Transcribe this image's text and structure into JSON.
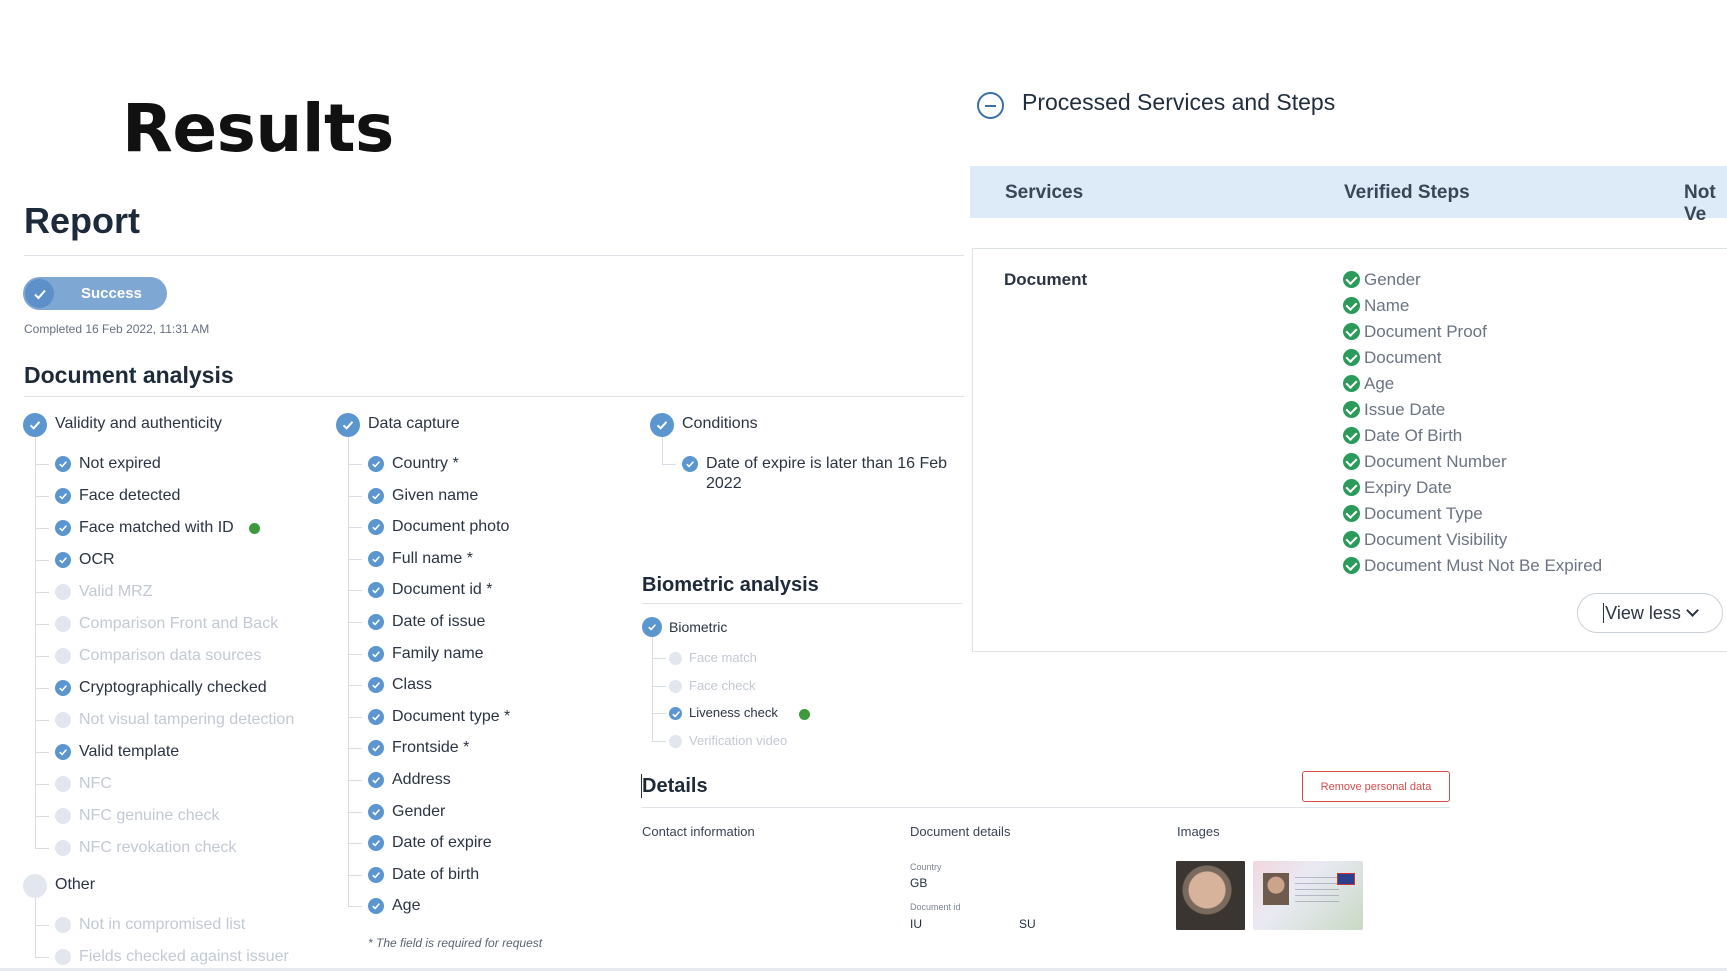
{
  "slide": {
    "title": "Results"
  },
  "report": {
    "title": "Report",
    "status": "Success",
    "completed": "Completed 16 Feb 2022, 11:31 AM"
  },
  "document_analysis": {
    "title": "Document analysis",
    "validity": {
      "label": "Validity and authenticity",
      "items": [
        {
          "label": "Not expired",
          "checked": true
        },
        {
          "label": "Face detected",
          "checked": true
        },
        {
          "label": "Face matched with ID",
          "checked": true,
          "info": true
        },
        {
          "label": "OCR",
          "checked": true
        },
        {
          "label": "Valid MRZ",
          "checked": false
        },
        {
          "label": "Comparison Front and Back",
          "checked": false
        },
        {
          "label": "Comparison data sources",
          "checked": false
        },
        {
          "label": "Cryptographically checked",
          "checked": true
        },
        {
          "label": "Not visual tampering detection",
          "checked": false
        },
        {
          "label": "Valid template",
          "checked": true
        },
        {
          "label": "NFC",
          "checked": false
        },
        {
          "label": "NFC genuine check",
          "checked": false
        },
        {
          "label": "NFC revokation check",
          "checked": false
        }
      ]
    },
    "other": {
      "label": "Other",
      "items": [
        {
          "label": "Not in compromised list",
          "checked": false
        },
        {
          "label": "Fields checked against issuer",
          "checked": false
        }
      ]
    },
    "data_capture": {
      "label": "Data capture",
      "items": [
        {
          "label": "Country *"
        },
        {
          "label": "Given name"
        },
        {
          "label": "Document photo"
        },
        {
          "label": "Full name *"
        },
        {
          "label": "Document id *"
        },
        {
          "label": "Date of issue"
        },
        {
          "label": "Family name"
        },
        {
          "label": "Class"
        },
        {
          "label": "Document type *"
        },
        {
          "label": "Frontside *"
        },
        {
          "label": "Address"
        },
        {
          "label": "Gender"
        },
        {
          "label": "Date of expire"
        },
        {
          "label": "Date of birth"
        },
        {
          "label": "Age"
        }
      ],
      "footnote": "* The field is required for request"
    },
    "conditions": {
      "label": "Conditions",
      "item_line1": "Date of expire is later than 16 Feb",
      "item_line2": "2022"
    }
  },
  "biometric_analysis": {
    "title": "Biometric analysis",
    "group": "Biometric",
    "items": [
      {
        "label": "Face match",
        "checked": false
      },
      {
        "label": "Face check",
        "checked": false
      },
      {
        "label": "Liveness check",
        "checked": true,
        "info": true
      },
      {
        "label": "Verification video",
        "checked": false
      }
    ]
  },
  "details": {
    "title": "Details",
    "remove_button": "Remove personal data",
    "contact_label": "Contact information",
    "document_details_label": "Document details",
    "images_label": "Images",
    "country_label": "Country",
    "country_value": "GB",
    "document_id_label": "Document id",
    "document_id_value_1": "IU",
    "document_id_value_2": "SU"
  },
  "processed": {
    "title": "Processed Services and Steps",
    "columns": [
      "Services",
      "Verified Steps",
      "Not Ve"
    ],
    "service": "Document",
    "verified_steps": [
      "Gender",
      "Name",
      "Document Proof",
      "Document",
      "Age",
      "Issue Date",
      "Date Of Birth",
      "Document Number",
      "Expiry Date",
      "Document Type",
      "Document Visibility",
      "Document Must Not Be Expired"
    ],
    "view_less": "View less"
  },
  "icons": {
    "check": "check-icon",
    "info": "info-dot-icon",
    "collapse": "minus-circle-icon",
    "chevron": "chevron-down-icon"
  },
  "colors": {
    "accent_blue": "#5b96cf",
    "success_green": "#2c9a5a",
    "header_bg": "#ddebf9",
    "danger": "#d84a4a"
  }
}
